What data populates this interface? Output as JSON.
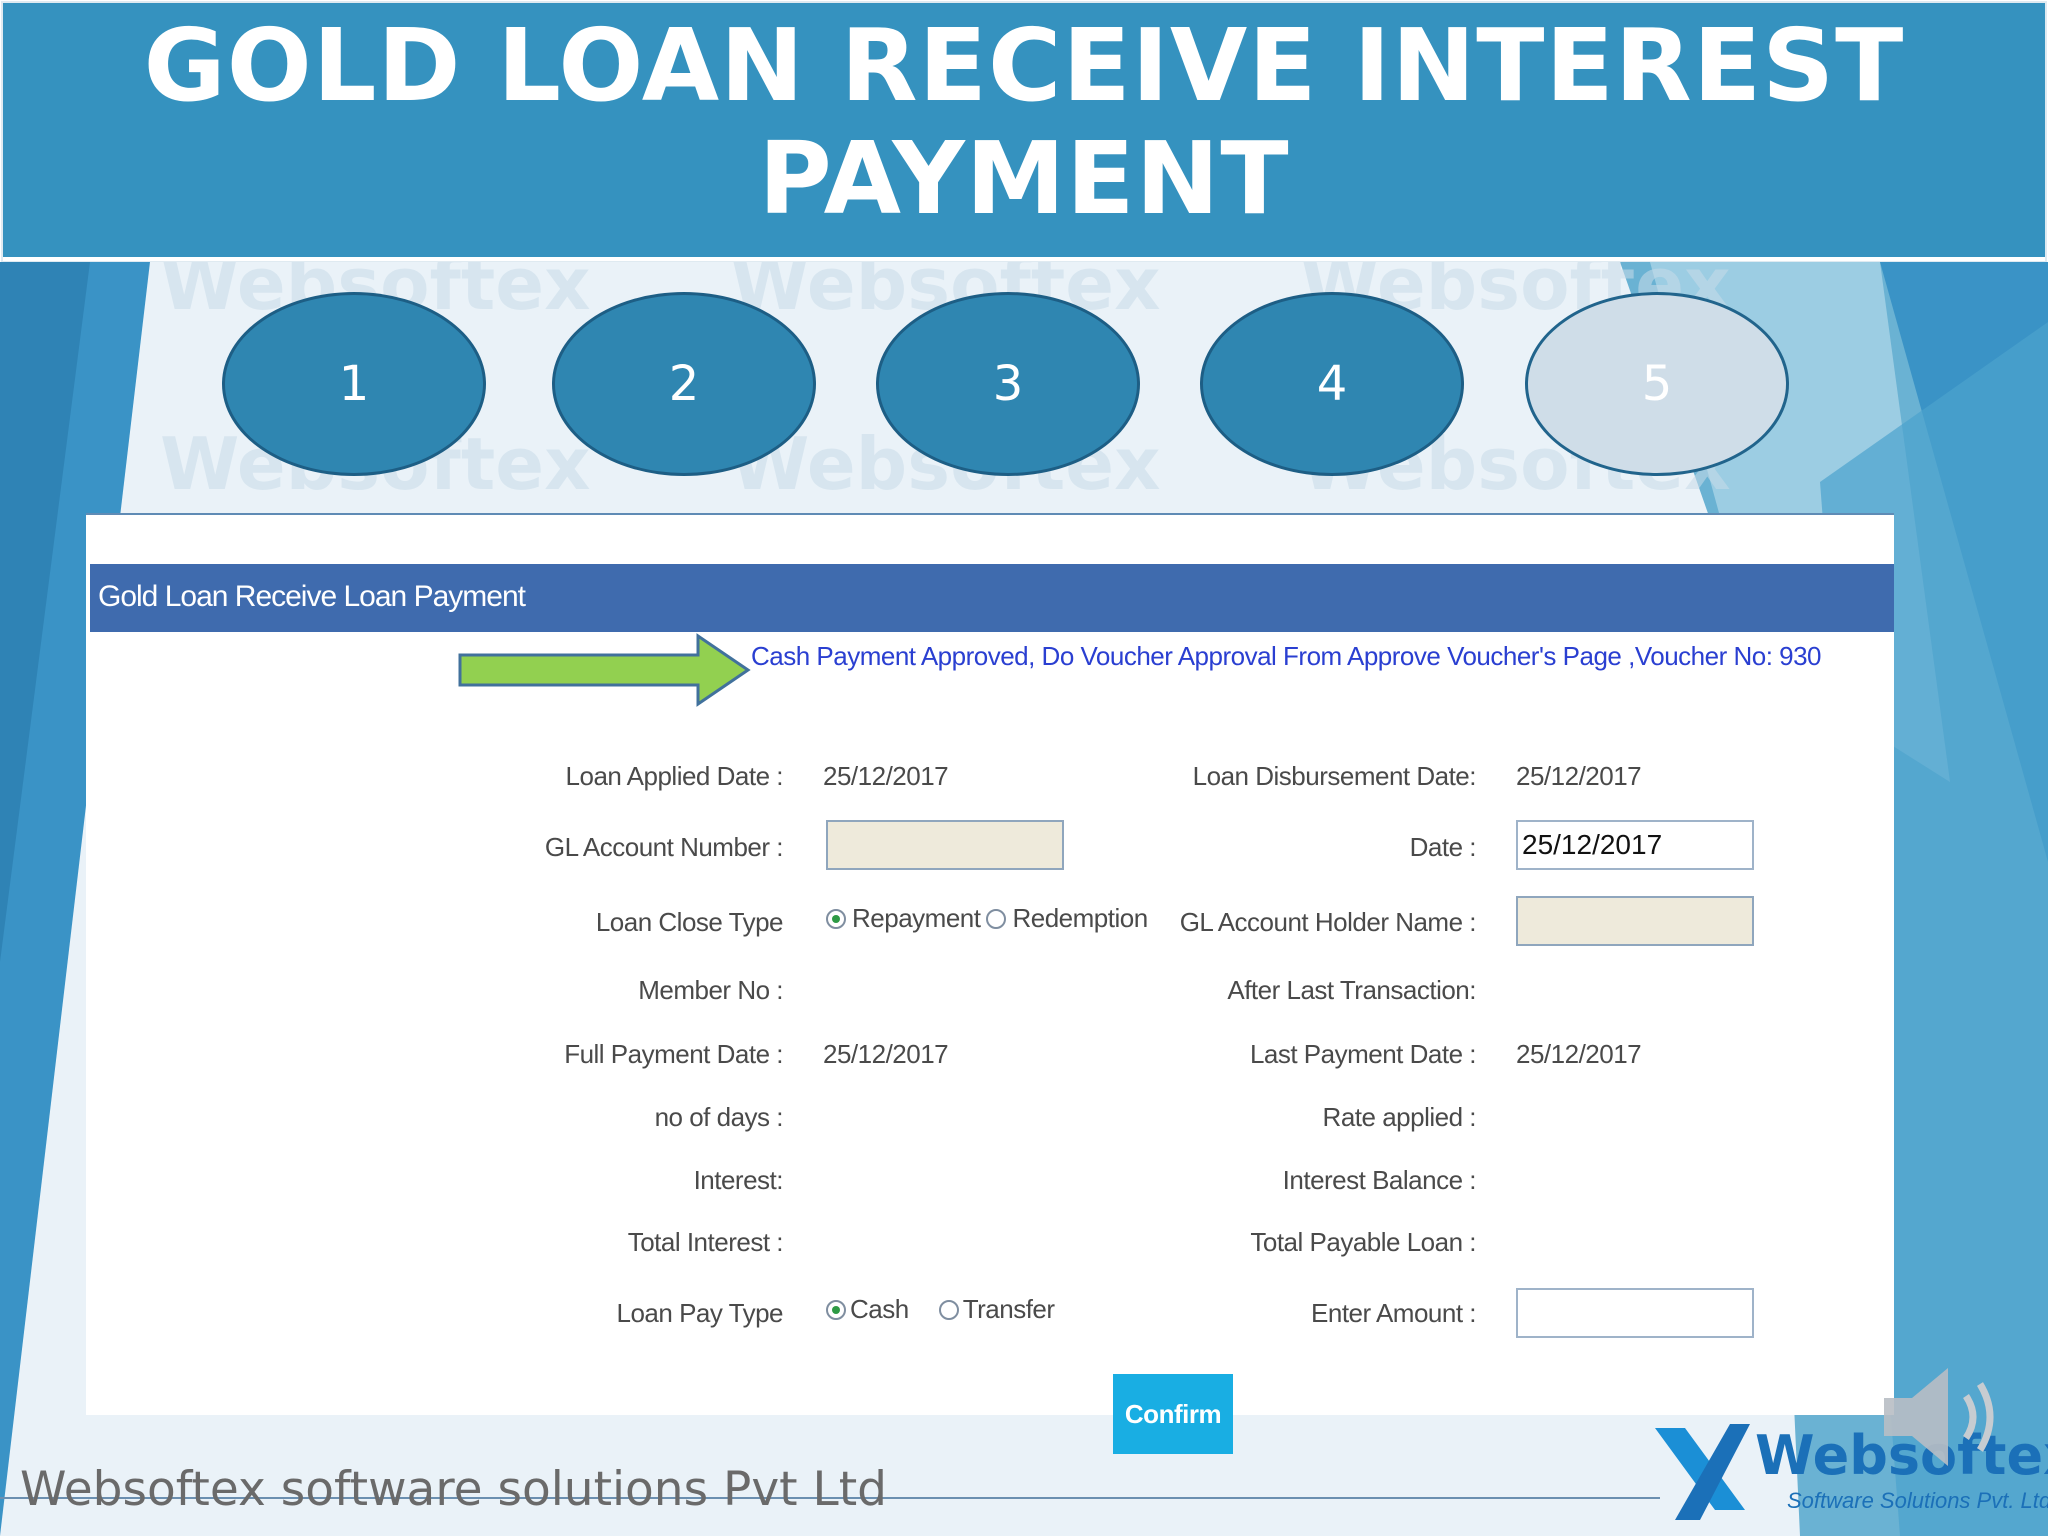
{
  "slide": {
    "title": "GOLD LOAN RECEIVE INTEREST PAYMENT",
    "steps": [
      "1",
      "2",
      "3",
      "4",
      "5"
    ],
    "active_step": "5",
    "watermark": "Websoftex",
    "footer": "Websoftex software solutions Pvt Ltd",
    "logo": {
      "name": "Websoftex",
      "tagline": "Software Solutions Pvt. Ltd."
    }
  },
  "form": {
    "window_title": "Gold Loan Receive Loan Payment",
    "message": "Cash Payment Approved, Do Voucher Approval From Approve Voucher's Page ,Voucher No: 930",
    "fields": {
      "loan_applied_date": {
        "label": "Loan Applied Date :",
        "value": "25/12/2017"
      },
      "loan_disbursement_date": {
        "label": "Loan Disbursement Date:",
        "value": "25/12/2017"
      },
      "gl_account_number": {
        "label": "GL Account Number :",
        "value": ""
      },
      "date": {
        "label": "Date :",
        "value": "25/12/2017"
      },
      "loan_close_type": {
        "label": "Loan Close Type",
        "options": [
          "Repayment",
          "Redemption"
        ],
        "selected": "Repayment"
      },
      "gl_account_holder_name": {
        "label": "GL Account Holder Name :",
        "value": ""
      },
      "member_no": {
        "label": "Member No :",
        "value": ""
      },
      "after_last_transaction": {
        "label": "After Last Transaction:",
        "value": ""
      },
      "full_payment_date": {
        "label": "Full Payment Date :",
        "value": "25/12/2017"
      },
      "last_payment_date": {
        "label": "Last Payment Date :",
        "value": "25/12/2017"
      },
      "no_of_days": {
        "label": "no of days :",
        "value": ""
      },
      "rate_applied": {
        "label": "Rate applied :",
        "value": ""
      },
      "interest": {
        "label": "Interest:",
        "value": ""
      },
      "interest_balance": {
        "label": "Interest Balance :",
        "value": ""
      },
      "total_interest": {
        "label": "Total Interest :",
        "value": ""
      },
      "total_payable_loan": {
        "label": "Total Payable Loan :",
        "value": ""
      },
      "loan_pay_type": {
        "label": "Loan Pay Type",
        "options": [
          "Cash",
          "Transfer"
        ],
        "selected": "Cash"
      },
      "enter_amount": {
        "label": "Enter Amount :",
        "value": ""
      }
    },
    "confirm_label": "Confirm"
  },
  "colors": {
    "banner": "#3592bf",
    "step": "#2f86b1",
    "step_active": "#cfdde8",
    "titlebar": "#3f6bae",
    "message": "#2a3fd1",
    "arrow": "#92d050",
    "confirm": "#19aee3"
  }
}
